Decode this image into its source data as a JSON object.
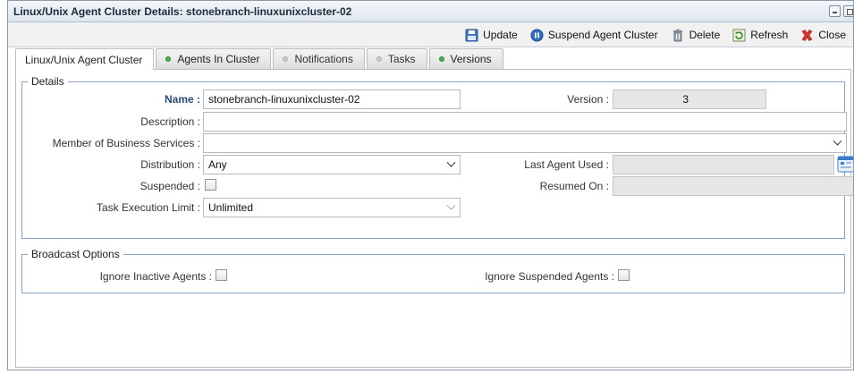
{
  "window": {
    "title": "Linux/Unix Agent Cluster Details: stonebranch-linuxunixcluster-02"
  },
  "toolbar": {
    "update": "Update",
    "suspend": "Suspend Agent Cluster",
    "delete": "Delete",
    "refresh": "Refresh",
    "close": "Close"
  },
  "tabs": [
    {
      "label": "Linux/Unix Agent Cluster",
      "active": true
    },
    {
      "label": "Agents In Cluster",
      "status": "green"
    },
    {
      "label": "Notifications",
      "status": "gray"
    },
    {
      "label": "Tasks",
      "status": "gray"
    },
    {
      "label": "Versions",
      "status": "green"
    }
  ],
  "details": {
    "legend": "Details",
    "name_label": "Name :",
    "name_value": "stonebranch-linuxunixcluster-02",
    "version_label": "Version :",
    "version_value": "3",
    "description_label": "Description :",
    "description_value": "",
    "business_services_label": "Member of Business Services :",
    "business_services_value": "",
    "distribution_label": "Distribution :",
    "distribution_value": "Any",
    "last_agent_label": "Last Agent Used :",
    "last_agent_value": "",
    "suspended_label": "Suspended :",
    "suspended_checked": false,
    "resumed_label": "Resumed On :",
    "resumed_value": "",
    "task_limit_label": "Task Execution Limit :",
    "task_limit_value": "Unlimited"
  },
  "broadcast": {
    "legend": "Broadcast Options",
    "ignore_inactive_label": "Ignore Inactive Agents :",
    "ignore_inactive_checked": false,
    "ignore_suspended_label": "Ignore Suspended Agents :",
    "ignore_suspended_checked": false
  },
  "colors": {
    "accent_blue": "#2a4a7a",
    "status_green": "#3cb64a",
    "status_gray": "#c9c9c9",
    "close_red": "#d9342b"
  },
  "icons": {
    "update": "save-disk-icon",
    "suspend": "pause-circle-icon",
    "delete": "trash-icon",
    "refresh": "refresh-icon",
    "close": "close-x-icon",
    "calendar": "calendar-icon"
  }
}
